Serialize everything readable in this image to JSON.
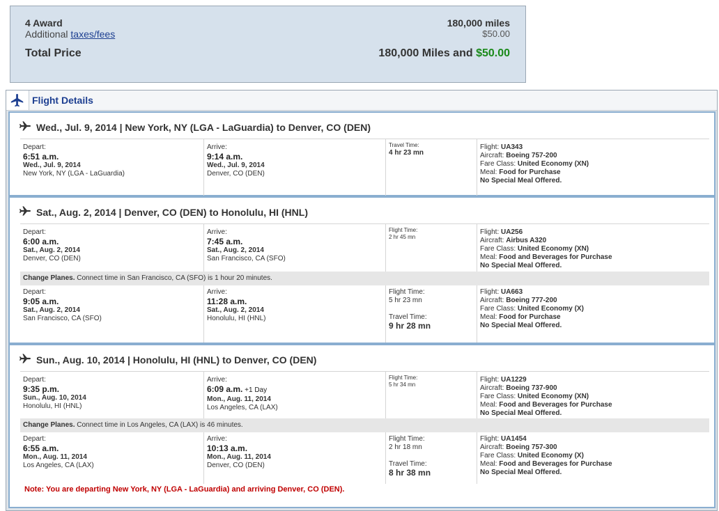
{
  "price": {
    "award_label": "4 Award",
    "award_value": "180,000 miles",
    "additional_prefix": "Additional ",
    "taxes_link": "taxes/fees",
    "taxes_value": "$50.00",
    "total_label": "Total Price",
    "total_miles": "180,000 Miles and ",
    "total_cash": "$50.00"
  },
  "flight_details": {
    "title": "Flight Details",
    "trips": [
      {
        "header": "Wed., Jul. 9, 2014 | New York, NY (LGA - LaGuardia) to Denver, CO (DEN)",
        "segments": [
          {
            "depart_label": "Depart:",
            "depart_time": "6:51 a.m.",
            "depart_date": "Wed., Jul. 9, 2014",
            "depart_city": "New York, NY (LGA - LaGuardia)",
            "arrive_label": "Arrive:",
            "arrive_time": "9:14 a.m.",
            "arrive_extra": "",
            "arrive_date": "Wed., Jul. 9, 2014",
            "arrive_city": "Denver, CO (DEN)",
            "time_label": "Travel Time:",
            "time_value": "4 hr 23 mn",
            "flight_label": "Flight:",
            "flight": "UA343",
            "aircraft_label": "Aircraft:",
            "aircraft": "Boeing 757-200",
            "fare_label": "Fare Class:",
            "fare": "United Economy (XN)",
            "meal_label": "Meal:",
            "meal": "Food for Purchase",
            "special": "No Special Meal Offered."
          }
        ]
      },
      {
        "header": "Sat., Aug. 2, 2014 | Denver, CO (DEN) to Honolulu, HI (HNL)",
        "segments": [
          {
            "depart_label": "Depart:",
            "depart_time": "6:00 a.m.",
            "depart_date": "Sat., Aug. 2, 2014",
            "depart_city": "Denver, CO (DEN)",
            "arrive_label": "Arrive:",
            "arrive_time": "7:45 a.m.",
            "arrive_extra": "",
            "arrive_date": "Sat., Aug. 2, 2014",
            "arrive_city": "San Francisco, CA (SFO)",
            "time_label": "Flight Time:",
            "time_value": "2 hr 45 mn",
            "flight_label": "Flight:",
            "flight": "UA256",
            "aircraft_label": "Aircraft:",
            "aircraft": "Airbus A320",
            "fare_label": "Fare Class:",
            "fare": "United Economy (XN)",
            "meal_label": "Meal:",
            "meal": "Food and Beverages for Purchase",
            "special": "No Special Meal Offered."
          },
          {
            "depart_label": "Depart:",
            "depart_time": "9:05 a.m.",
            "depart_date": "Sat., Aug. 2, 2014",
            "depart_city": "San Francisco, CA (SFO)",
            "arrive_label": "Arrive:",
            "arrive_time": "11:28 a.m.",
            "arrive_extra": "",
            "arrive_date": "Sat., Aug. 2, 2014",
            "arrive_city": "Honolulu, HI (HNL)",
            "time_label": "Flight Time:",
            "time_value": "5 hr 23 mn",
            "total_label": "Travel Time:",
            "total_value": "9 hr 28 mn",
            "flight_label": "Flight:",
            "flight": "UA663",
            "aircraft_label": "Aircraft:",
            "aircraft": "Boeing 777-200",
            "fare_label": "Fare Class:",
            "fare": "United Economy (X)",
            "meal_label": "Meal:",
            "meal": "Food for Purchase",
            "special": "No Special Meal Offered."
          }
        ],
        "connection": {
          "label": "Change Planes.",
          "text": " Connect time in San Francisco, CA (SFO) is 1 hour 20 minutes."
        }
      },
      {
        "header": "Sun., Aug. 10, 2014 | Honolulu, HI (HNL) to Denver, CO (DEN)",
        "segments": [
          {
            "depart_label": "Depart:",
            "depart_time": "9:35 p.m.",
            "depart_date": "Sun., Aug. 10, 2014",
            "depart_city": "Honolulu, HI (HNL)",
            "arrive_label": "Arrive:",
            "arrive_time": "6:09 a.m.",
            "arrive_extra": " +1 Day",
            "arrive_date": "Mon., Aug. 11, 2014",
            "arrive_city": "Los Angeles, CA (LAX)",
            "time_label": "Flight Time:",
            "time_value": "5 hr 34 mn",
            "flight_label": "Flight:",
            "flight": "UA1229",
            "aircraft_label": "Aircraft:",
            "aircraft": "Boeing 737-900",
            "fare_label": "Fare Class:",
            "fare": "United Economy (XN)",
            "meal_label": "Meal:",
            "meal": "Food and Beverages for Purchase",
            "special": "No Special Meal Offered."
          },
          {
            "depart_label": "Depart:",
            "depart_time": "6:55 a.m.",
            "depart_date": "Mon., Aug. 11, 2014",
            "depart_city": "Los Angeles, CA (LAX)",
            "arrive_label": "Arrive:",
            "arrive_time": "10:13 a.m.",
            "arrive_extra": "",
            "arrive_date": "Mon., Aug. 11, 2014",
            "arrive_city": "Denver, CO (DEN)",
            "time_label": "Flight Time:",
            "time_value": "2 hr 18 mn",
            "total_label": "Travel Time:",
            "total_value": "8 hr 38 mn",
            "flight_label": "Flight:",
            "flight": "UA1454",
            "aircraft_label": "Aircraft:",
            "aircraft": "Boeing 757-300",
            "fare_label": "Fare Class:",
            "fare": "United Economy (X)",
            "meal_label": "Meal:",
            "meal": "Food and Beverages for Purchase",
            "special": "No Special Meal Offered."
          }
        ],
        "connection": {
          "label": "Change Planes.",
          "text": " Connect time in Los Angeles, CA (LAX) is 46 minutes."
        },
        "note": "Note: You are departing New York, NY (LGA - LaGuardia) and arriving Denver, CO (DEN)."
      }
    ]
  }
}
